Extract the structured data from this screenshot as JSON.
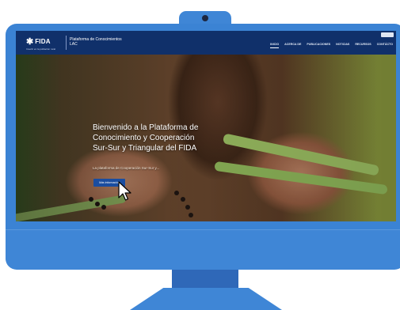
{
  "header": {
    "logo_text": "FIDA",
    "logo_tagline": "Invertir en la población rural",
    "platform_title": "Plataforma de Conocimientos LAC"
  },
  "nav": {
    "items": [
      "INICIO",
      "ACERCA DE",
      "PUBLICACIONES",
      "NOTICIAS",
      "RECURSOS",
      "CONTÁCTO"
    ],
    "active_index": 0
  },
  "hero": {
    "title": "Bienvenido a la Plataforma de Conocimiento y Cooperación Sur-Sur y Triangular del FIDA",
    "subtitle": "La plataforma de Cooperación Sur-Sur y...",
    "button_label": "Más información"
  },
  "colors": {
    "bezel": "#3b83d4",
    "header": "#10306a",
    "button": "#1a4da0"
  },
  "icons": {
    "logo": "fida-person-icon",
    "cursor": "mouse-pointer-icon"
  }
}
